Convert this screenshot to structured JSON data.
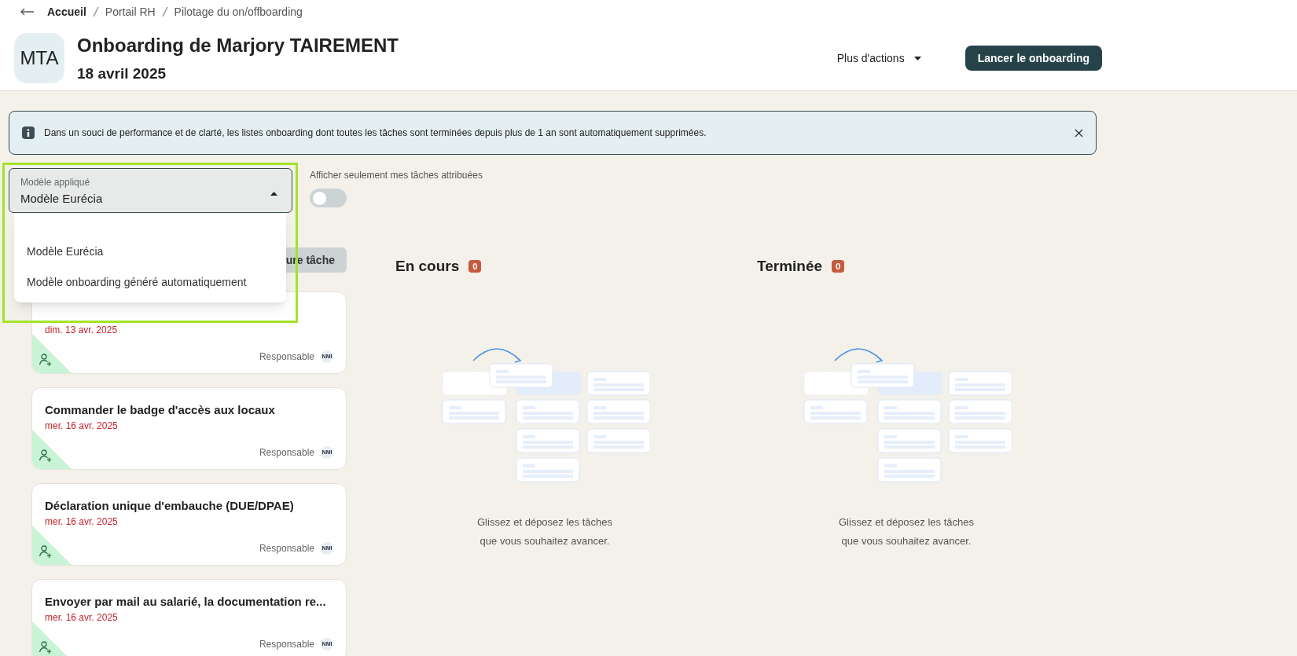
{
  "breadcrumb": [
    "Accueil",
    "Portail RH",
    "Pilotage du on/offboarding"
  ],
  "header": {
    "initials": "MTA",
    "title": "Onboarding de Marjory TAIREMENT",
    "date": "18 avril 2025",
    "more_actions": "Plus d'actions",
    "primary_button": "Lancer le onboarding"
  },
  "notice": {
    "text": "Dans un souci de performance et de clarté, les listes onboarding dont toutes les tâches sont terminées depuis plus de 1 an sont automatiquement supprimées."
  },
  "template_select": {
    "label": "Modèle appliqué",
    "value": "Modèle Eurécia",
    "expanded": true,
    "highlighted": true,
    "options": [
      "Modèle Eurécia",
      "Modèle onboarding généré automatiquement"
    ]
  },
  "filter_toggle": {
    "label": "Afficher seulement mes tâches attribuées",
    "on": false
  },
  "add_task_button": "ure tâche",
  "tasks": [
    {
      "date": "dim. 13 avr. 2025",
      "role": "Responsable",
      "assignee": "NMI"
    },
    {
      "title": "Commander le badge d'accès aux locaux",
      "date": "mer. 16 avr. 2025",
      "role": "Responsable",
      "assignee": "NMI"
    },
    {
      "title": "Déclaration unique d'embauche (DUE/DPAE)",
      "date": "mer. 16 avr. 2025",
      "role": "Responsable",
      "assignee": "NMI"
    },
    {
      "title": "Envoyer par mail au salarié, la documentation re...",
      "date": "mer. 16 avr. 2025",
      "role": "Responsable",
      "assignee": "NMI"
    }
  ],
  "columns": [
    {
      "title": "En cours",
      "count": "0",
      "empty_text": "Glissez et déposez les tâches que vous souhaitez avancer."
    },
    {
      "title": "Terminée",
      "count": "0",
      "empty_text": "Glissez et déposez les tâches que vous souhaitez avancer."
    }
  ]
}
